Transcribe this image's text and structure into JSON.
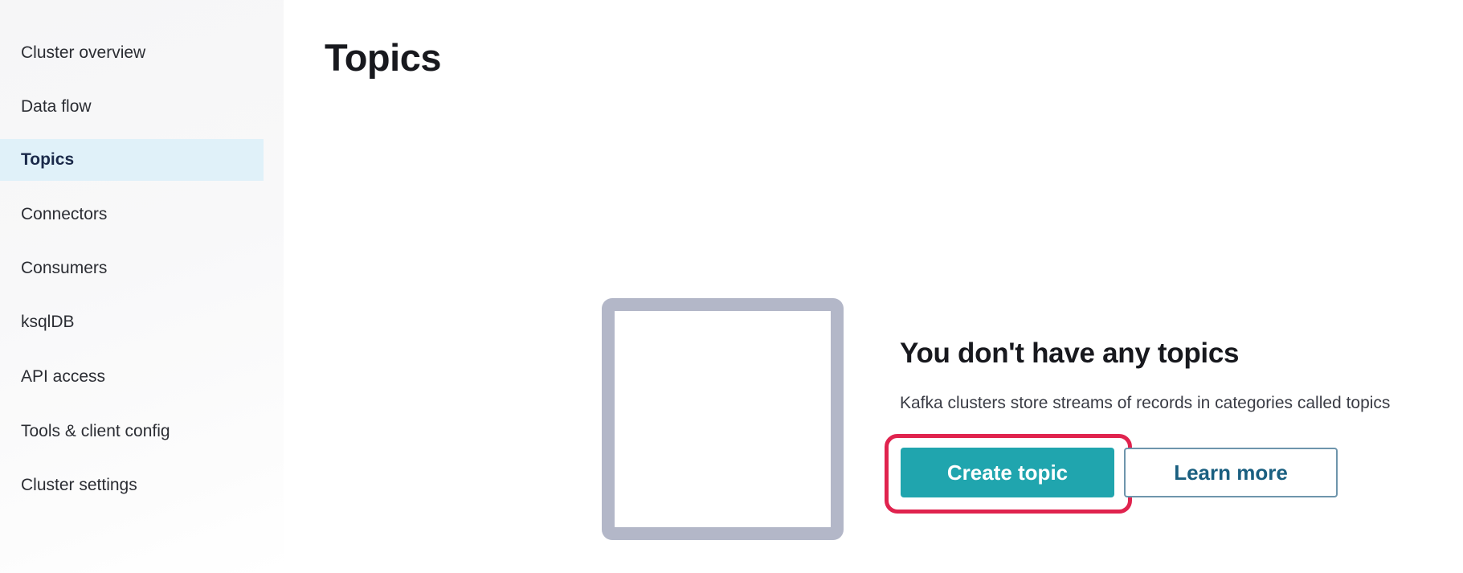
{
  "sidebar": {
    "items": [
      {
        "label": "Cluster overview",
        "active": false
      },
      {
        "label": "Data flow",
        "active": false
      },
      {
        "label": "Topics",
        "active": true
      },
      {
        "label": "Connectors",
        "active": false
      },
      {
        "label": "Consumers",
        "active": false
      },
      {
        "label": "ksqlDB",
        "active": false
      },
      {
        "label": "API access",
        "active": false
      },
      {
        "label": "Tools & client config",
        "active": false
      },
      {
        "label": "Cluster settings",
        "active": false
      }
    ]
  },
  "main": {
    "title": "Topics",
    "empty_state": {
      "icon": "empty-square-icon",
      "heading": "You don't have any topics",
      "description": "Kafka clusters store streams of records in categories called topics",
      "primary_button": "Create topic",
      "secondary_button": "Learn more"
    }
  },
  "colors": {
    "primary": "#20a5ae",
    "highlight": "#e0234e",
    "active_nav_bg": "#e0f1f9",
    "secondary_text": "#1a5f80"
  }
}
